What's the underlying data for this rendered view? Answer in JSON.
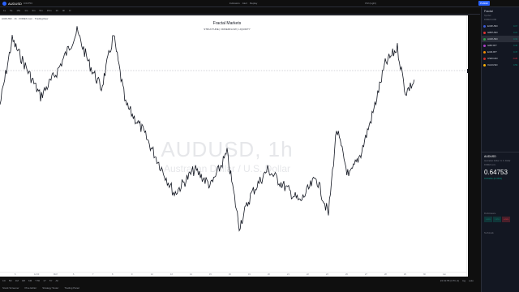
{
  "topbar": {
    "symbol": "AUDUSD",
    "price": "0.64753",
    "live_label": "Publish",
    "indicators_label": "Indicators",
    "alert_label": "Alert",
    "replay_label": "Replay",
    "theme_label": "FM (Light)",
    "timeframes": [
      "1s",
      "5s",
      "15s",
      "1m",
      "3m",
      "5m",
      "15m",
      "1h",
      "4h",
      "D"
    ]
  },
  "chart": {
    "symbol_line": "AUDUSD · 1h · FOREX.com · TradingView",
    "title": "Fractal Markets",
    "subtitle": "STRUCTURE | ORDERFLOW | LIQUIDITY",
    "watermark": "AUDUSD, 1h",
    "watermark_sub": "Australian Dollar / U.S. Dollar",
    "last_price": "0.64753",
    "price_ticks": [
      "0.6510",
      "0.6500",
      "0.6490",
      "0.6480",
      "0.6470",
      "0.6460",
      "0.6450",
      "0.6440",
      "0.6430",
      "0.6420",
      "0.6410",
      "0.6400",
      "0.6390",
      "0.6380",
      "0.6370",
      "0.6360",
      "0.6350",
      "0.6340",
      "0.6330",
      "0.6320",
      "0.6310",
      "0.6300",
      "0.6290",
      "0.6280",
      "0.6270",
      "0.6260",
      "0.6250",
      "0.6240",
      "0.6230",
      "0.6220",
      "0.6210",
      "0.6200",
      "0.6190",
      "0.6180",
      "0.6170",
      "0.6160",
      "0.6150",
      "0.6140",
      "0.6130",
      "0.6120",
      "0.6110",
      "0.6100",
      "0.6090"
    ],
    "time_ticks": [
      "6",
      "12:00",
      "MAY",
      "6",
      "7",
      "8",
      "9",
      "12",
      "13",
      "14",
      "15",
      "16",
      "19",
      "20",
      "21",
      "22",
      "23",
      "26",
      "27",
      "28",
      "29",
      "30",
      "Jun"
    ]
  },
  "bottombar": {
    "ranges": [
      "1D",
      "5D",
      "1M",
      "3M",
      "6M",
      "YTD",
      "1Y",
      "5Y",
      "All"
    ],
    "clock": "22:01:55 (UTC-4)",
    "log_label": "log",
    "auto_label": "auto"
  },
  "panels": [
    "Stock Screener",
    "Pine Editor",
    "Strategy Tester",
    "Trading Panel"
  ],
  "watchlist": {
    "header": "Fractal",
    "columns": "Symbol",
    "section": "FOREX.COM",
    "rows": [
      {
        "symbol": "EURUSD",
        "value": "0.17",
        "dir": "pos",
        "color": "#3b5bdb"
      },
      {
        "symbol": "GBPUSD",
        "value": "0.21",
        "dir": "pos",
        "color": "#e03131"
      },
      {
        "symbol": "AUDUSD",
        "value": "0.31",
        "dir": "pos",
        "color": "#2f9e44"
      },
      {
        "symbol": "GBPJPY",
        "value": "0.30",
        "dir": "pos",
        "color": "#ae3ec9"
      },
      {
        "symbol": "EURJPY",
        "value": "0.47",
        "dir": "pos",
        "color": "#f08c00"
      },
      {
        "symbol": "USDCAD",
        "value": "-0.26",
        "dir": "neg",
        "color": "#c92a2a"
      },
      {
        "symbol": "XAUUSD",
        "value": "0.59",
        "dir": "pos",
        "color": "#fab005"
      }
    ]
  },
  "details": {
    "symbol": "AUDUSD",
    "name": "Australian Dollar / U.S. Dollar",
    "exchange": "FOREX.com",
    "price": "0.64753",
    "change": "0.00231 (0.36%)",
    "performance_label": "Performance",
    "perf": [
      {
        "label": "0.51%",
        "dir": "pos"
      },
      {
        "label": "1.37%",
        "dir": "pos"
      },
      {
        "label": "-0.56%",
        "dir": "neg"
      }
    ],
    "technicals_label": "Technicals"
  }
}
